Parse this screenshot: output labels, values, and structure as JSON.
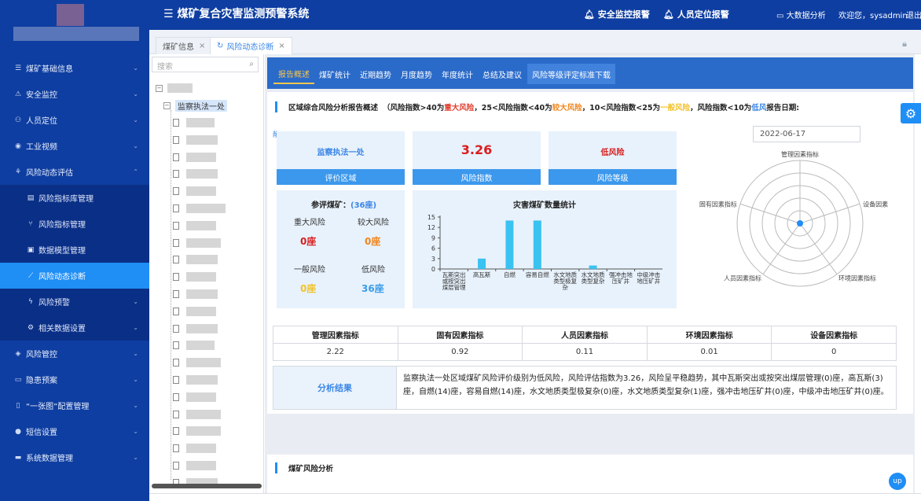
{
  "app": {
    "title": "煤矿复合灾害监测预警系统"
  },
  "topbar": {
    "alarm1": "安全监控报警",
    "alarm2": "人员定位报警",
    "bigdata": "大数据分析",
    "welcome": "欢迎您，sysadmin",
    "logout": "退出"
  },
  "sidebar": {
    "items": [
      {
        "label": "煤矿基础信息",
        "icon": "list-icon"
      },
      {
        "label": "安全监控",
        "icon": "warning-icon"
      },
      {
        "label": "人员定位",
        "icon": "person-icon"
      },
      {
        "label": "工业视频",
        "icon": "eye-icon"
      },
      {
        "label": "风险动态评估",
        "icon": "network-icon"
      }
    ],
    "subitems": [
      {
        "label": "风险指标库管理"
      },
      {
        "label": "风险指标管理"
      },
      {
        "label": "数据模型管理"
      },
      {
        "label": "风险动态诊断"
      },
      {
        "label": "风险预警"
      },
      {
        "label": "相关数据设置"
      }
    ],
    "items2": [
      {
        "label": "风险管控"
      },
      {
        "label": "隐患预案"
      },
      {
        "label": "“一张图”配置管理"
      },
      {
        "label": "短信设置"
      },
      {
        "label": "系统数据管理"
      }
    ]
  },
  "tabs": [
    {
      "label": "煤矿信息"
    },
    {
      "label": "风险动态诊断"
    }
  ],
  "tree": {
    "search_placeholder": "搜索",
    "node1": "监察执法一处"
  },
  "subtabs": [
    "报告概述",
    "煤矿统计",
    "近期趋势",
    "月度趋势",
    "年度统计",
    "总结及建议",
    "风险等级评定标准下载"
  ],
  "report": {
    "h1": "区域综合风险分析报告概述",
    "p_open": "（风险指数>40为",
    "lvl1": "重大风险",
    "p2": "，25<风险指数<40为",
    "lvl2": "较大风险",
    "p3": "，10<风险指数<25为",
    "lvl3": "一般风险",
    "p4": "，风险指数<10为",
    "lvl4": "低风",
    "p5": " 报告日期:",
    "area": "监察执法一处",
    "area_label": "评价区域",
    "index": "3.26",
    "index_label": "风险指数",
    "level": "低风险",
    "level_label": "风险等级",
    "mines_title": "参评煤矿：",
    "mines_count": "(36座)",
    "r1": "重大风险",
    "r1v": "0座",
    "r2": "较大风险",
    "r2v": "0座",
    "r3": "一般风险",
    "r3v": "0座",
    "r4": "低风险",
    "r4v": "36座",
    "date": "2022-06-17"
  },
  "chart_data": {
    "type": "bar",
    "title": "灾害煤矿数量统计",
    "categories": [
      "瓦斯突出或按突出煤层管理",
      "高瓦斯",
      "自燃",
      "容易自燃",
      "水文地质类型极复杂",
      "水文地质类型复杂",
      "强冲击地压矿井",
      "中级冲击地压矿井"
    ],
    "cat_lines": [
      [
        "瓦斯突出",
        "或按突出",
        "煤层管理"
      ],
      [
        "高瓦斯"
      ],
      [
        "自燃"
      ],
      [
        "容易自燃"
      ],
      [
        "水文地质",
        "类型极复",
        "杂"
      ],
      [
        "水文地质",
        "类型复杂"
      ],
      [
        "强冲击地",
        "压矿井"
      ],
      [
        "中级冲击",
        "地压矿井"
      ]
    ],
    "values": [
      0,
      3,
      14,
      14,
      0,
      1,
      0,
      0
    ],
    "yticks": [
      0,
      3,
      6,
      9,
      12,
      15
    ],
    "ylim": [
      0,
      15
    ],
    "color": "#3ac2f1"
  },
  "radar": {
    "labels": [
      "管理因素指标",
      "设备因素",
      "环境因素指标",
      "人员因素指标",
      "固有因素指标"
    ]
  },
  "indicators": {
    "headers": [
      "管理因素指标",
      "固有因素指标",
      "人员因素指标",
      "环境因素指标",
      "设备因素指标"
    ],
    "values": [
      "2.22",
      "0.92",
      "0.11",
      "0.01",
      "0"
    ]
  },
  "analysis": {
    "label": "分析结果",
    "text": "监察执法一处区域煤矿风险评价级别为低风险，风险评估指数为3.26，风险呈平稳趋势，其中瓦斯突出或按突出煤层管理(0)座，高瓦斯(3)座，自燃(14)座，容易自燃(14)座，水文地质类型极复杂(0)座，水文地质类型复杂(1)座，强冲击地压矿井(0)座，中级冲击地压矿井(0)座。"
  },
  "section2": {
    "title": "煤矿风险分析"
  },
  "misc": {
    "up": "up",
    "side_char": "敞"
  }
}
